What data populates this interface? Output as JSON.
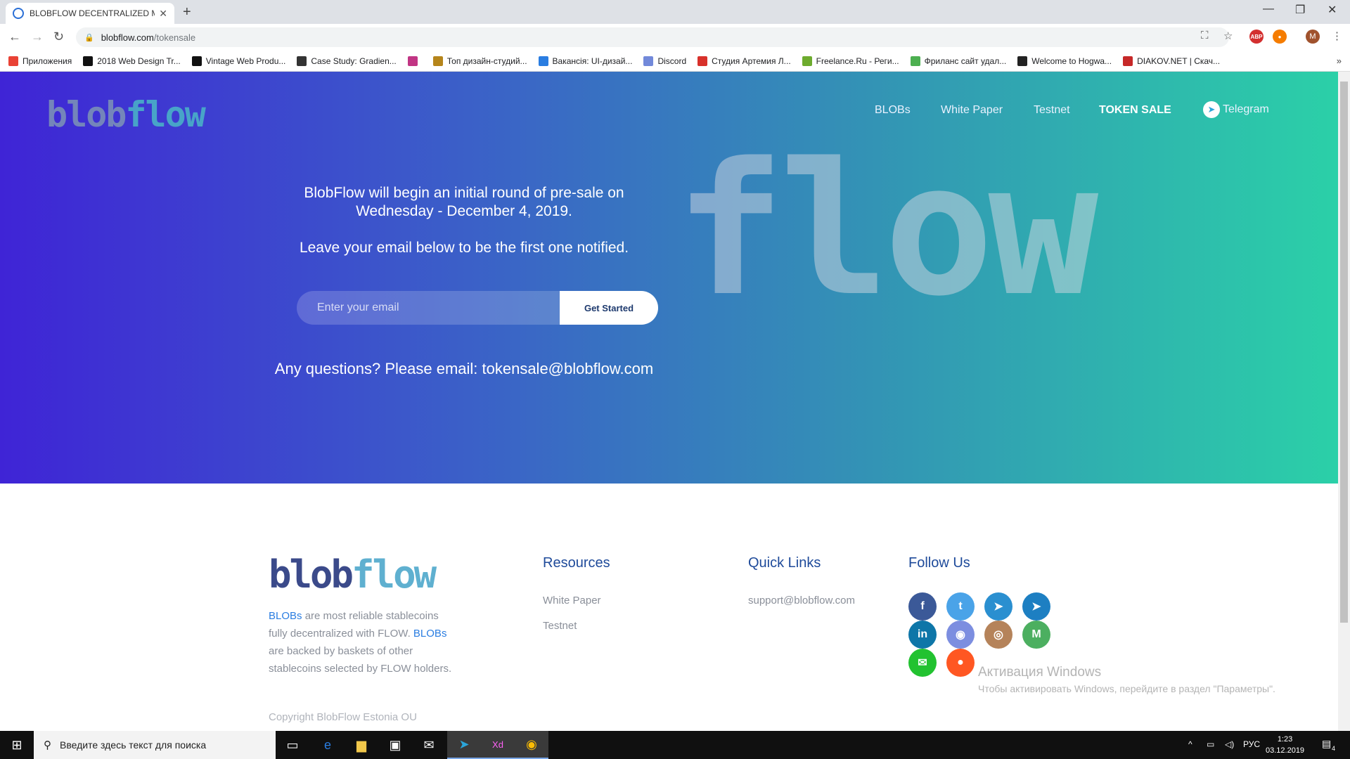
{
  "browser": {
    "tab_title": "BLOBFLOW DECENTRALIZED MO",
    "url_host": "blobflow.com",
    "url_path": "/tokensale",
    "profile_initial": "M",
    "bookmarks": [
      {
        "label": "Приложения",
        "icon": "apps-grid-icon",
        "color": "#e94235"
      },
      {
        "label": "2018 Web Design Tr...",
        "icon": "uxpin-icon",
        "color": "#111111"
      },
      {
        "label": "Vintage Web Produ...",
        "icon": "slash-icon",
        "color": "#111111"
      },
      {
        "label": "Case Study: Gradien...",
        "icon": "mountain-icon",
        "color": "#333333"
      },
      {
        "label": "",
        "icon": "instagram-icon",
        "color": "#c13584"
      },
      {
        "label": "Топ дизайн-студий...",
        "icon": "ruler-icon",
        "color": "#b5851b"
      },
      {
        "label": "Вакансія: UI-дизай...",
        "icon": "target-icon",
        "color": "#2a7de1"
      },
      {
        "label": "Discord",
        "icon": "discord-icon",
        "color": "#7289da"
      },
      {
        "label": "Студия Артемия Л...",
        "icon": "studio-icon",
        "color": "#d8312b"
      },
      {
        "label": "Freelance.Ru - Реги...",
        "icon": "freelance-icon",
        "color": "#6dab2e"
      },
      {
        "label": "Фриланс сайт удал...",
        "icon": "fl-icon",
        "color": "#4caf50"
      },
      {
        "label": "Welcome to Hogwa...",
        "icon": "hogwarts-icon",
        "color": "#222222"
      },
      {
        "label": "DIAKOV.NET | Скач...",
        "icon": "diakov-icon",
        "color": "#c62828"
      }
    ]
  },
  "hero": {
    "nav": {
      "blobs": "BLOBs",
      "white_paper": "White Paper",
      "testnet": "Testnet",
      "token_sale": "TOKEN SALE",
      "telegram": "Telegram"
    },
    "line1": "BlobFlow will begin an initial round of pre-sale on Wednesday - December 4, 2019.",
    "line2": "Leave your email below to be the first one notified.",
    "email_placeholder": "Enter your email",
    "button_label": "Get Started",
    "questions": "Any questions? Please email: tokensale@blobflow.com"
  },
  "footer": {
    "desc_parts": [
      "BLOBs",
      " are most reliable stablecoins fully decentralized with FLOW. ",
      "BLOBs",
      " are backed by baskets of other stablecoins selected by FLOW holders."
    ],
    "copyright": "Copyright BlobFlow Estonia OU",
    "resources_title": "Resources",
    "resources": [
      "White Paper",
      "Testnet"
    ],
    "quick_title": "Quick Links",
    "quick": [
      "support@blobflow.com"
    ],
    "follow_title": "Follow Us",
    "social": [
      {
        "name": "facebook-icon",
        "glyph": "f",
        "color": "#3b5998"
      },
      {
        "name": "twitter-icon",
        "glyph": "t",
        "color": "#4aa3e8"
      },
      {
        "name": "telegram-icon",
        "glyph": "➤",
        "color": "#2a8fd0"
      },
      {
        "name": "telegram-alt-icon",
        "glyph": "➤",
        "color": "#1d7fc2"
      },
      {
        "name": "linkedin-icon",
        "glyph": "in",
        "color": "#0e76a8"
      },
      {
        "name": "discord-icon",
        "glyph": "◉",
        "color": "#7c8ee0"
      },
      {
        "name": "instagram-icon",
        "glyph": "◎",
        "color": "#b5835a"
      },
      {
        "name": "medium-icon",
        "glyph": "M",
        "color": "#4caf60"
      },
      {
        "name": "wechat-icon",
        "glyph": "✉",
        "color": "#22c230"
      },
      {
        "name": "reddit-icon",
        "glyph": "●",
        "color": "#ff5722"
      }
    ]
  },
  "watermark": {
    "title": "Активация Windows",
    "subtitle": "Чтобы активировать Windows, перейдите в раздел \"Параметры\"."
  },
  "taskbar": {
    "search_placeholder": "Введите здесь текст для поиска",
    "lang": "РУС",
    "time": "1:23",
    "date": "03.12.2019",
    "notifications": "4"
  }
}
